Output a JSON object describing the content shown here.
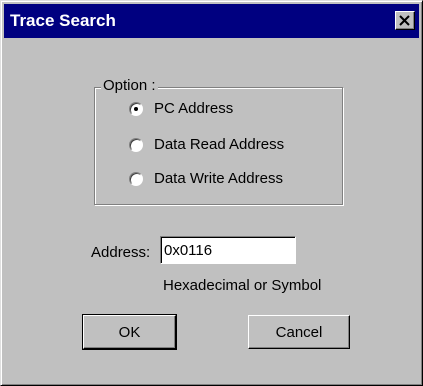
{
  "window": {
    "title": "Trace Search",
    "close_icon": "close-icon"
  },
  "option_group": {
    "legend": "Option :",
    "options": [
      {
        "label": "PC Address",
        "selected": true
      },
      {
        "label": "Data Read Address",
        "selected": false
      },
      {
        "label": "Data Write Address",
        "selected": false
      }
    ]
  },
  "address": {
    "label": "Address:",
    "value": "0x0116",
    "hint": "Hexadecimal or Symbol"
  },
  "buttons": {
    "ok_label": "OK",
    "cancel_label": "Cancel"
  },
  "colors": {
    "titlebar": "#000080",
    "dialog_face": "#c0c0c0"
  }
}
